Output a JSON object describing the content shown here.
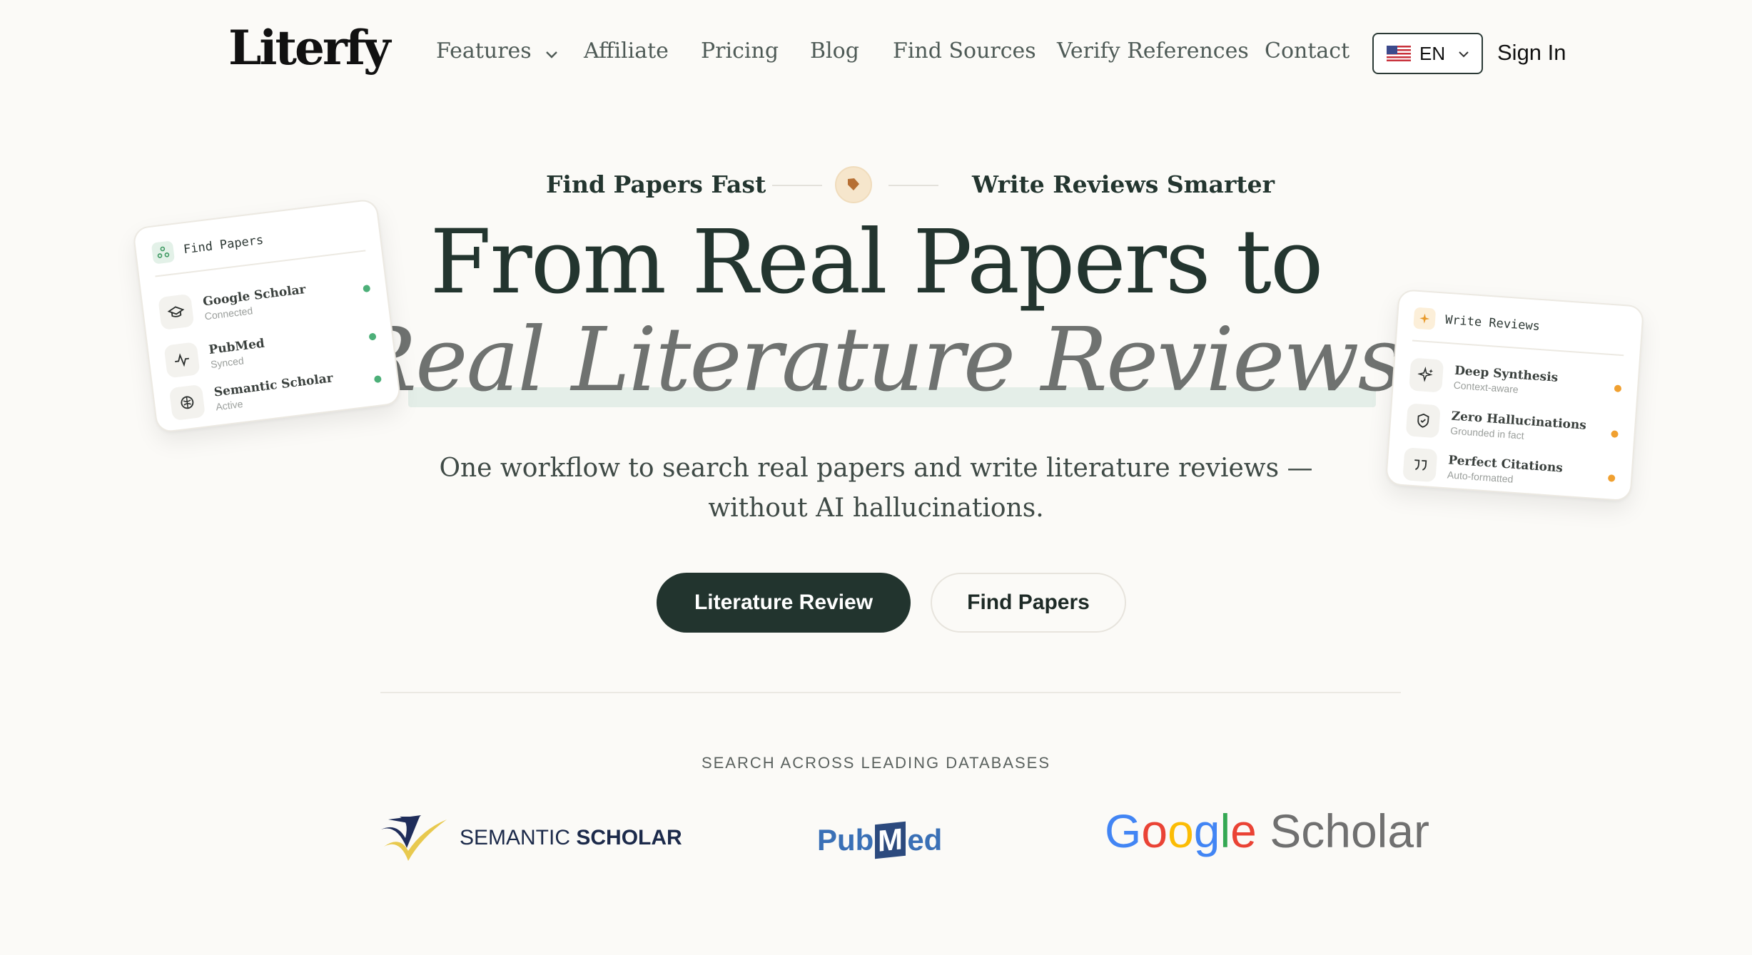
{
  "nav": {
    "logo": "Literfy",
    "links": [
      {
        "label": "Features",
        "has_dropdown": true
      },
      {
        "label": "Affiliate"
      },
      {
        "label": "Pricing"
      },
      {
        "label": "Blog"
      },
      {
        "label": "Find Sources"
      },
      {
        "label": "Verify References"
      },
      {
        "label": "Contact"
      }
    ],
    "language": {
      "code": "EN",
      "flag": "us-flag-icon"
    },
    "signin": "Sign In"
  },
  "hero": {
    "tag_left": "Find Papers Fast",
    "tag_right": "Write Reviews Smarter",
    "badge_icon": "tag-icon",
    "title_line1": "From Real Papers to",
    "title_line2": "Real Literature Reviews",
    "subtitle_line1": "One workflow to search real papers and write literature reviews —",
    "subtitle_line2": "without AI hallucinations.",
    "primary_button": "Literature Review",
    "secondary_button": "Find Papers"
  },
  "databases": {
    "heading": "SEARCH ACROSS LEADING DATABASES",
    "semantic_scholar": {
      "part1": "SEMANTIC ",
      "part2": "SCHOLAR"
    },
    "pubmed": {
      "pre": "Pub",
      "m": "M",
      "post": "ed"
    },
    "google_scholar": {
      "g1": "G",
      "o1": "o",
      "o2": "o",
      "g2": "g",
      "l": "l",
      "e": "e",
      "scholar": " Scholar"
    }
  },
  "card_left": {
    "title": "Find Papers",
    "items": [
      {
        "title": "Google Scholar",
        "status": "Connected",
        "icon": "graduation-cap-icon"
      },
      {
        "title": "PubMed",
        "status": "Synced",
        "icon": "activity-icon"
      },
      {
        "title": "Semantic Scholar",
        "status": "Active",
        "icon": "brain-icon"
      }
    ],
    "dot_color": "#4caf78"
  },
  "card_right": {
    "title": "Write Reviews",
    "items": [
      {
        "title": "Deep Synthesis",
        "status": "Context-aware",
        "icon": "sparkles-icon"
      },
      {
        "title": "Zero Hallucinations",
        "status": "Grounded in fact",
        "icon": "shield-icon"
      },
      {
        "title": "Perfect Citations",
        "status": "Auto-formatted",
        "icon": "quote-icon"
      }
    ],
    "dot_color": "#f0a030"
  },
  "colors": {
    "primary": "#22342e",
    "background": "#fbfaf7",
    "muted_title": "#6f7270"
  }
}
